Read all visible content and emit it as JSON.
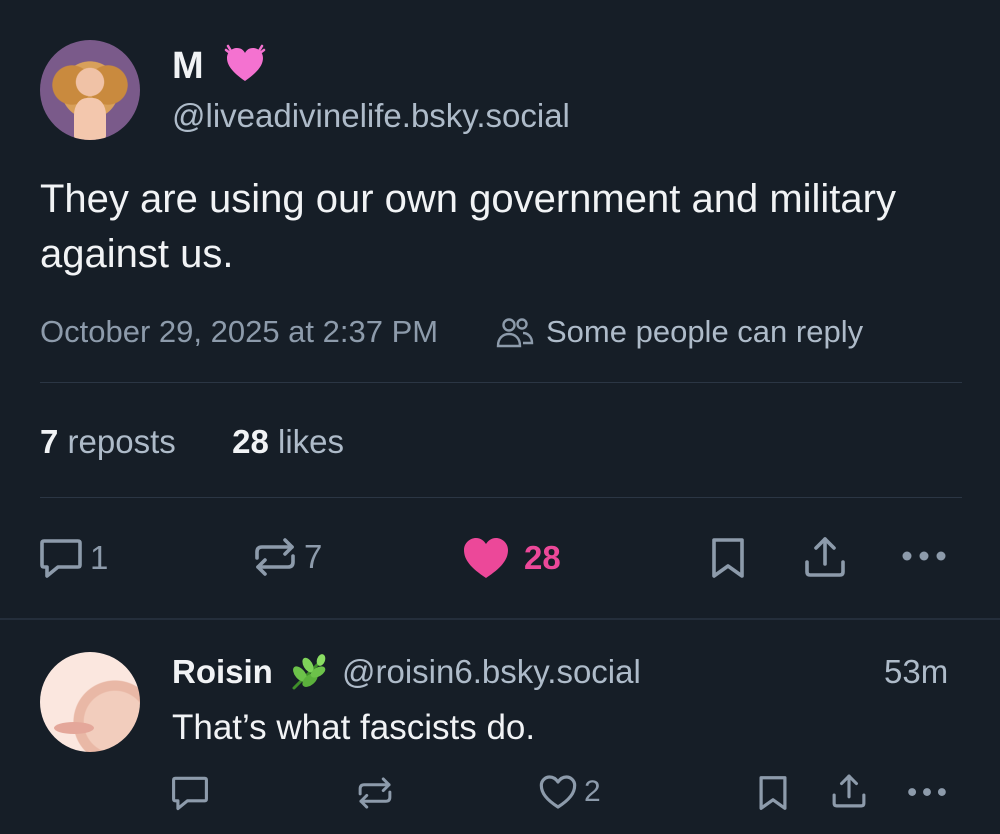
{
  "post": {
    "display_name": "M",
    "name_emoji": "heart-emoji",
    "handle": "@liveadivinelife.bsky.social",
    "text": "They are using our own government and military against us.",
    "date": "October 29, 2025 at 2:37 PM",
    "reply_setting": "Some people can reply",
    "reposts_count": "7",
    "reposts_label": "reposts",
    "likes_count": "28",
    "likes_label": "likes",
    "actions": {
      "reply_count": "1",
      "repost_count": "7",
      "like_count": "28"
    }
  },
  "reply": {
    "display_name": "Roisin",
    "name_emoji": "leaf-emoji",
    "handle": "@roisin6.bsky.social",
    "time": "53m",
    "text": "That’s what fascists do.",
    "actions": {
      "like_count": "2"
    }
  },
  "colors": {
    "background": "#161e27",
    "like_pink": "#ec4899",
    "muted_text": "#8d9bab",
    "divider": "#2b3644"
  }
}
